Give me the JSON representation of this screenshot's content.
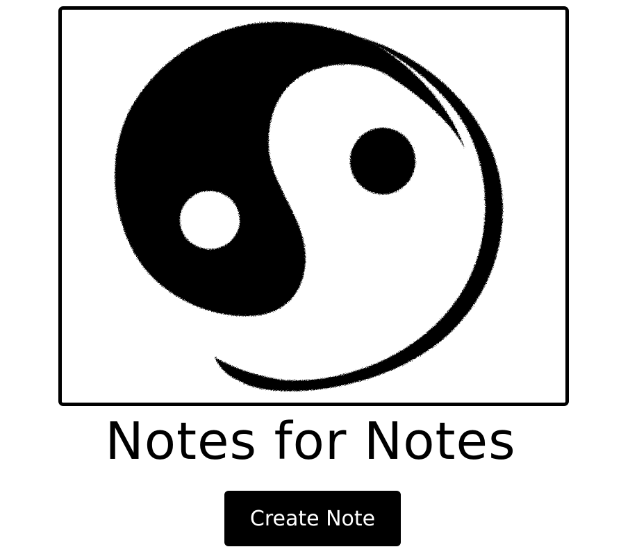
{
  "hero": {
    "image": "yin-yang-brush-icon"
  },
  "title": "Notes for Notes",
  "actions": {
    "create_label": "Create Note"
  },
  "colors": {
    "background": "#ffffff",
    "ink": "#000000",
    "button_text": "#ffffff"
  }
}
